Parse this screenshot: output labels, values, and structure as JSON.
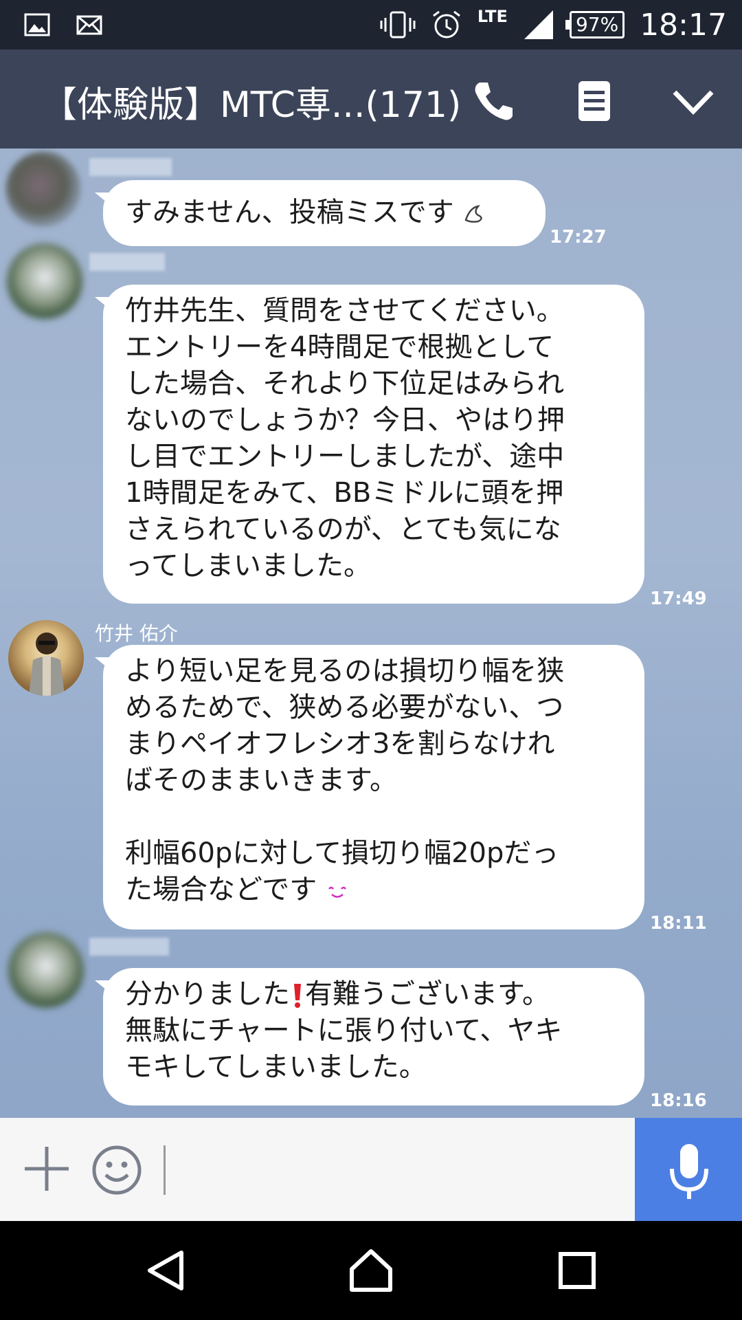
{
  "status_bar": {
    "network": "LTE",
    "battery": "97%",
    "clock": "18:17",
    "icons": [
      "image-icon",
      "mail-icon",
      "vibrate-icon",
      "alarm-icon",
      "signal-icon"
    ]
  },
  "header": {
    "title": "【体験版】MTC専...(171)",
    "icons": [
      "phone-icon",
      "memo-icon",
      "chevron-down-icon"
    ]
  },
  "messages": [
    {
      "sender": "",
      "lines": [
        "すみません、投稿ミスです"
      ],
      "emoji": "sweat-emoji",
      "time": "17:27"
    },
    {
      "sender": "",
      "lines": [
        "竹井先生、質問をさせてください。",
        "エントリーを4時間足で根拠として",
        "した場合、それより下位足はみられ",
        "ないのでしょうか？今日、やはり押",
        "し目でエントリーしましたが、途中",
        "1時間足をみて、BBミドルに頭を押",
        "さえられているのが、とても気にな",
        "ってしまいました。"
      ],
      "time": "17:49"
    },
    {
      "sender": "竹井 佑介",
      "lines": [
        "より短い足を見るのは損切り幅を狭",
        "めるためで、狭める必要がない、つ",
        "まりペイオフレシオ3を割らなけれ",
        "ばそのままいきます。",
        "",
        "利幅60pに対して損切り幅20pだっ",
        "た場合などです"
      ],
      "emoji": "smile-emoji",
      "time": "18:11"
    },
    {
      "sender": "",
      "lines": [
        "分かりました",
        "無駄にチャートに張り付いて、ヤキ",
        "モキしてしまいました。"
      ],
      "line1_suffix": "有難うございます。",
      "time": "18:16"
    }
  ],
  "input_bar": {
    "icons": [
      "plus-icon",
      "emoji-icon",
      "microphone-icon"
    ]
  },
  "nav_bar": {
    "icons": [
      "back-icon",
      "home-icon",
      "recents-icon"
    ]
  },
  "colors": {
    "header": "#3c4459",
    "status_bar": "#1e2430",
    "chat_background": "#9fb2ce",
    "bubble": "#ffffff",
    "mic_button": "#4c7fe3"
  }
}
